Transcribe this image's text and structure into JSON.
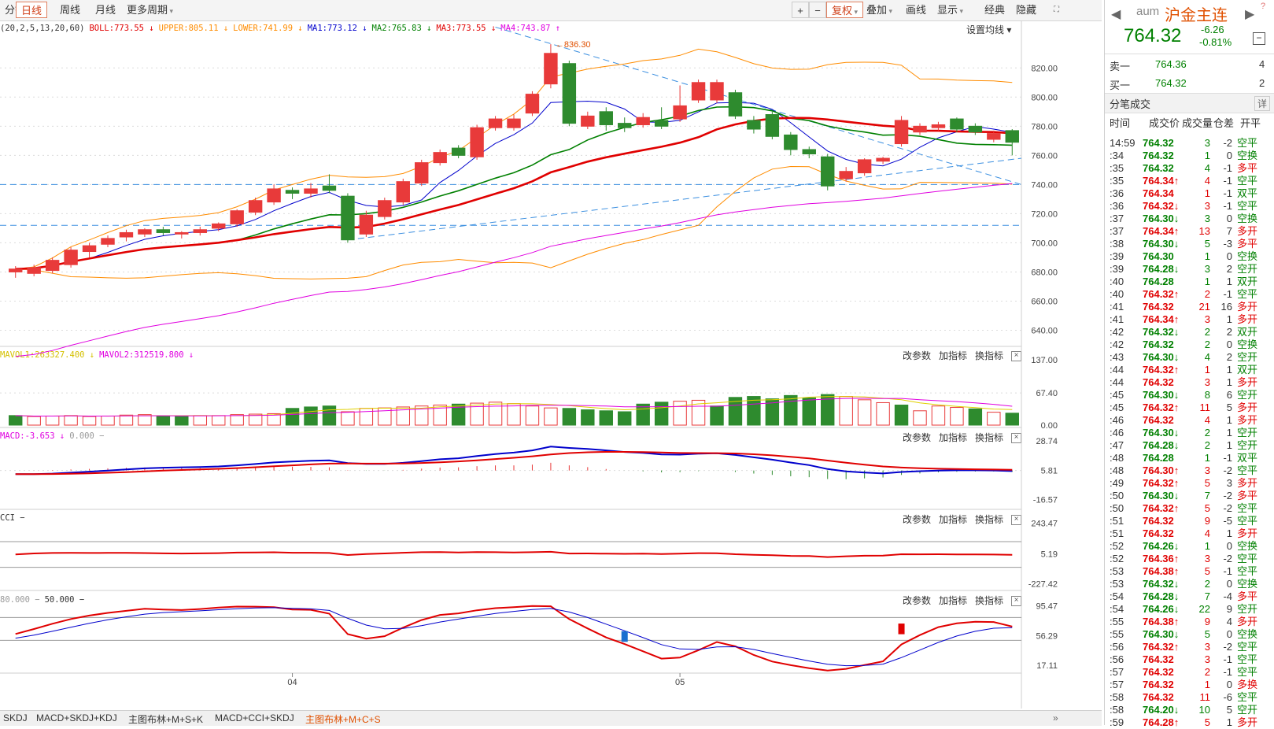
{
  "toolbar": {
    "period_tabs": [
      "分钟",
      "日线",
      "周线",
      "月线",
      "更多周期"
    ],
    "selected_tab": "日线",
    "buttons": [
      "+",
      "−",
      "复权",
      "叠加",
      "画线",
      "显示",
      "经典",
      "隐藏"
    ],
    "selected_button": "复权"
  },
  "main_legend": [
    {
      "text": "(20,2,5,13,20,60)",
      "color": "#333333"
    },
    {
      "text": "BOLL:773.55 ↓",
      "color": "#e00000"
    },
    {
      "text": "UPPER:805.11 ↓",
      "color": "#ff8c00"
    },
    {
      "text": "LOWER:741.99 ↓",
      "color": "#ff8c00"
    },
    {
      "text": "MA1:773.12 ↓",
      "color": "#0000cc"
    },
    {
      "text": "MA2:765.83 ↓",
      "color": "#008000"
    },
    {
      "text": "MA3:773.55 ↓",
      "color": "#e00000"
    },
    {
      "text": "MA4:743.87 ↑",
      "color": "#e000e0"
    }
  ],
  "settings_label": "设置均线",
  "price_axis": [
    "820.00",
    "800.00",
    "780.00",
    "760.00",
    "740.00",
    "720.00",
    "700.00",
    "680.00",
    "660.00",
    "640.00"
  ],
  "peak_label": "836.30",
  "vol_legend": [
    {
      "text": "MAVOL1:263327.400 ↓",
      "color": "#d4c000"
    },
    {
      "text": "MAVOL2:312519.800 ↓",
      "color": "#e000e0"
    }
  ],
  "vol_axis": [
    "137.00",
    "67.40",
    "0.00"
  ],
  "macd_legend": [
    {
      "text": "MACD:-3.653 ↓",
      "color": "#e000e0"
    },
    {
      "text": "0.000 −",
      "color": "#999999"
    }
  ],
  "macd_axis": [
    "28.74",
    "5.81",
    "-16.57"
  ],
  "cci_legend": [
    {
      "text": "CCI −",
      "color": "#333333"
    }
  ],
  "cci_axis": [
    "243.47",
    "5.19",
    "-227.42"
  ],
  "kdj_legend": [
    {
      "text": "80.000 −",
      "color": "#999999"
    },
    {
      "text": "50.000 −",
      "color": "#333333"
    }
  ],
  "kdj_axis": [
    "95.47",
    "56.29",
    "17.11"
  ],
  "pane_tools": [
    "改参数",
    "加指标",
    "换指标"
  ],
  "date_labels": [
    "04",
    "05"
  ],
  "bottom_tabs": [
    "SKDJ",
    "MACD+SKDJ+KDJ",
    "主图布林+M+S+K",
    "MACD+CCI+SKDJ",
    "主图布林+M+C+S"
  ],
  "selected_bottom_tab": "主图布林+M+C+S",
  "quote": {
    "code": "aum",
    "name": "沪金主连",
    "price": "764.32",
    "change": "-6.26",
    "change_pct": "-0.81%",
    "sell_label": "卖一",
    "sell_price": "764.36",
    "sell_vol": "4",
    "buy_label": "买一",
    "buy_price": "764.32",
    "buy_vol": "2",
    "ticks_title": "分笔成交",
    "detail_label": "详",
    "header": [
      "时间",
      "成交价",
      "成交量",
      "仓差",
      "开平"
    ]
  },
  "ticks": [
    {
      "t": "14:59",
      "p": "764.32",
      "a": "",
      "v": "3",
      "d": "-2",
      "k": "空平",
      "c": "dn"
    },
    {
      "t": ":34",
      "p": "764.32",
      "a": "",
      "v": "1",
      "d": "0",
      "k": "空换",
      "c": "dn"
    },
    {
      "t": ":35",
      "p": "764.32",
      "a": "",
      "v": "4",
      "d": "-1",
      "k": "多平",
      "c": "dn"
    },
    {
      "t": ":35",
      "p": "764.34",
      "a": "↑",
      "v": "4",
      "d": "-1",
      "k": "空平",
      "c": "up"
    },
    {
      "t": ":36",
      "p": "764.34",
      "a": "",
      "v": "1",
      "d": "-1",
      "k": "双平",
      "c": "up"
    },
    {
      "t": ":36",
      "p": "764.32",
      "a": "↓",
      "v": "3",
      "d": "-1",
      "k": "空平",
      "c": "up"
    },
    {
      "t": ":37",
      "p": "764.30",
      "a": "↓",
      "v": "3",
      "d": "0",
      "k": "空换",
      "c": "dn"
    },
    {
      "t": ":37",
      "p": "764.34",
      "a": "↑",
      "v": "13",
      "d": "7",
      "k": "多开",
      "c": "up"
    },
    {
      "t": ":38",
      "p": "764.30",
      "a": "↓",
      "v": "5",
      "d": "-3",
      "k": "多平",
      "c": "dn"
    },
    {
      "t": ":39",
      "p": "764.30",
      "a": "",
      "v": "1",
      "d": "0",
      "k": "空换",
      "c": "dn"
    },
    {
      "t": ":39",
      "p": "764.28",
      "a": "↓",
      "v": "3",
      "d": "2",
      "k": "空开",
      "c": "dn"
    },
    {
      "t": ":40",
      "p": "764.28",
      "a": "",
      "v": "1",
      "d": "1",
      "k": "双开",
      "c": "dn"
    },
    {
      "t": ":40",
      "p": "764.32",
      "a": "↑",
      "v": "2",
      "d": "-1",
      "k": "空平",
      "c": "up"
    },
    {
      "t": ":41",
      "p": "764.32",
      "a": "",
      "v": "21",
      "d": "16",
      "k": "多开",
      "c": "up"
    },
    {
      "t": ":41",
      "p": "764.34",
      "a": "↑",
      "v": "3",
      "d": "1",
      "k": "多开",
      "c": "up"
    },
    {
      "t": ":42",
      "p": "764.32",
      "a": "↓",
      "v": "2",
      "d": "2",
      "k": "双开",
      "c": "dn"
    },
    {
      "t": ":42",
      "p": "764.32",
      "a": "",
      "v": "2",
      "d": "0",
      "k": "空换",
      "c": "dn"
    },
    {
      "t": ":43",
      "p": "764.30",
      "a": "↓",
      "v": "4",
      "d": "2",
      "k": "空开",
      "c": "dn"
    },
    {
      "t": ":44",
      "p": "764.32",
      "a": "↑",
      "v": "1",
      "d": "1",
      "k": "双开",
      "c": "up"
    },
    {
      "t": ":44",
      "p": "764.32",
      "a": "",
      "v": "3",
      "d": "1",
      "k": "多开",
      "c": "up"
    },
    {
      "t": ":45",
      "p": "764.30",
      "a": "↓",
      "v": "8",
      "d": "6",
      "k": "空开",
      "c": "dn"
    },
    {
      "t": ":45",
      "p": "764.32",
      "a": "↑",
      "v": "11",
      "d": "5",
      "k": "多开",
      "c": "up"
    },
    {
      "t": ":46",
      "p": "764.32",
      "a": "",
      "v": "4",
      "d": "1",
      "k": "多开",
      "c": "up"
    },
    {
      "t": ":46",
      "p": "764.30",
      "a": "↓",
      "v": "2",
      "d": "1",
      "k": "空开",
      "c": "dn"
    },
    {
      "t": ":47",
      "p": "764.28",
      "a": "↓",
      "v": "2",
      "d": "1",
      "k": "空开",
      "c": "dn"
    },
    {
      "t": ":48",
      "p": "764.28",
      "a": "",
      "v": "1",
      "d": "-1",
      "k": "双平",
      "c": "dn"
    },
    {
      "t": ":48",
      "p": "764.30",
      "a": "↑",
      "v": "3",
      "d": "-2",
      "k": "空平",
      "c": "up"
    },
    {
      "t": ":49",
      "p": "764.32",
      "a": "↑",
      "v": "5",
      "d": "3",
      "k": "多开",
      "c": "up"
    },
    {
      "t": ":50",
      "p": "764.30",
      "a": "↓",
      "v": "7",
      "d": "-2",
      "k": "多平",
      "c": "dn"
    },
    {
      "t": ":50",
      "p": "764.32",
      "a": "↑",
      "v": "5",
      "d": "-2",
      "k": "空平",
      "c": "up"
    },
    {
      "t": ":51",
      "p": "764.32",
      "a": "",
      "v": "9",
      "d": "-5",
      "k": "空平",
      "c": "up"
    },
    {
      "t": ":51",
      "p": "764.32",
      "a": "",
      "v": "4",
      "d": "1",
      "k": "多开",
      "c": "up"
    },
    {
      "t": ":52",
      "p": "764.26",
      "a": "↓",
      "v": "1",
      "d": "0",
      "k": "空换",
      "c": "dn"
    },
    {
      "t": ":52",
      "p": "764.36",
      "a": "↑",
      "v": "3",
      "d": "-2",
      "k": "空平",
      "c": "up"
    },
    {
      "t": ":53",
      "p": "764.38",
      "a": "↑",
      "v": "5",
      "d": "-1",
      "k": "空平",
      "c": "up"
    },
    {
      "t": ":53",
      "p": "764.32",
      "a": "↓",
      "v": "2",
      "d": "0",
      "k": "空换",
      "c": "dn"
    },
    {
      "t": ":54",
      "p": "764.28",
      "a": "↓",
      "v": "7",
      "d": "-4",
      "k": "多平",
      "c": "dn"
    },
    {
      "t": ":54",
      "p": "764.26",
      "a": "↓",
      "v": "22",
      "d": "9",
      "k": "空开",
      "c": "dn"
    },
    {
      "t": ":55",
      "p": "764.38",
      "a": "↑",
      "v": "9",
      "d": "4",
      "k": "多开",
      "c": "up"
    },
    {
      "t": ":55",
      "p": "764.30",
      "a": "↓",
      "v": "5",
      "d": "0",
      "k": "空换",
      "c": "dn"
    },
    {
      "t": ":56",
      "p": "764.32",
      "a": "↑",
      "v": "3",
      "d": "-2",
      "k": "空平",
      "c": "up"
    },
    {
      "t": ":56",
      "p": "764.32",
      "a": "",
      "v": "3",
      "d": "-1",
      "k": "空平",
      "c": "up"
    },
    {
      "t": ":57",
      "p": "764.32",
      "a": "",
      "v": "2",
      "d": "-1",
      "k": "空平",
      "c": "up"
    },
    {
      "t": ":57",
      "p": "764.32",
      "a": "",
      "v": "1",
      "d": "0",
      "k": "多换",
      "c": "up"
    },
    {
      "t": ":58",
      "p": "764.32",
      "a": "",
      "v": "11",
      "d": "-6",
      "k": "空平",
      "c": "up"
    },
    {
      "t": ":58",
      "p": "764.20",
      "a": "↓",
      "v": "10",
      "d": "5",
      "k": "空开",
      "c": "dn"
    },
    {
      "t": ":59",
      "p": "764.28",
      "a": "↑",
      "v": "5",
      "d": "1",
      "k": "多开",
      "c": "up"
    }
  ],
  "chart_data": {
    "type": "candlestick",
    "candles": [
      [
        680,
        682,
        676,
        684
      ],
      [
        679,
        683,
        677,
        685
      ],
      [
        681,
        688,
        679,
        690
      ],
      [
        685,
        695,
        683,
        697
      ],
      [
        694,
        698,
        690,
        700
      ],
      [
        699,
        703,
        697,
        705
      ],
      [
        704,
        707,
        701,
        709
      ],
      [
        706,
        709,
        704,
        710
      ],
      [
        709,
        707,
        705,
        711
      ],
      [
        706,
        707,
        703,
        708
      ],
      [
        707,
        709,
        705,
        711
      ],
      [
        710,
        713,
        708,
        714
      ],
      [
        713,
        722,
        711,
        723
      ],
      [
        721,
        729,
        719,
        731
      ],
      [
        728,
        737,
        726,
        740
      ],
      [
        736,
        734,
        730,
        738
      ],
      [
        734,
        737,
        731,
        741
      ],
      [
        739,
        736,
        734,
        747
      ],
      [
        732,
        702,
        700,
        734
      ],
      [
        706,
        719,
        704,
        722
      ],
      [
        718,
        729,
        716,
        731
      ],
      [
        728,
        742,
        726,
        744
      ],
      [
        741,
        755,
        739,
        757
      ],
      [
        755,
        762,
        753,
        764
      ],
      [
        765,
        760,
        758,
        767
      ],
      [
        759,
        779,
        757,
        781
      ],
      [
        779,
        785,
        777,
        787
      ],
      [
        779,
        785,
        777,
        788
      ],
      [
        789,
        802,
        787,
        804
      ],
      [
        809,
        830,
        806,
        836.3
      ],
      [
        823,
        782,
        780,
        825
      ],
      [
        780,
        787,
        778,
        790
      ],
      [
        790,
        781,
        777,
        793
      ],
      [
        782,
        779,
        776,
        786
      ],
      [
        781,
        786,
        779,
        789
      ],
      [
        784,
        780,
        778,
        793
      ],
      [
        785,
        794,
        783,
        808
      ],
      [
        798,
        810,
        796,
        812
      ],
      [
        798,
        810,
        796,
        812
      ],
      [
        803,
        787,
        785,
        805
      ],
      [
        784,
        778,
        775,
        787
      ],
      [
        788,
        773,
        771,
        790
      ],
      [
        774,
        764,
        760,
        776
      ],
      [
        764,
        761,
        758,
        766
      ],
      [
        759,
        739,
        736,
        761
      ],
      [
        744,
        749,
        742,
        752
      ],
      [
        748,
        757,
        746,
        758
      ],
      [
        756,
        758,
        754,
        759
      ],
      [
        768,
        784,
        766,
        787
      ],
      [
        776,
        780,
        774,
        782
      ],
      [
        779,
        781,
        777,
        783
      ],
      [
        785,
        778,
        776,
        786
      ],
      [
        780,
        776,
        774,
        782
      ],
      [
        771,
        775,
        769,
        777
      ],
      [
        777,
        769,
        760,
        778
      ]
    ],
    "price_axis_range": [
      630,
      845
    ],
    "volumes": [
      20,
      18,
      19,
      20,
      18,
      19,
      21,
      22,
      19,
      18,
      20,
      20,
      22,
      23,
      24,
      35,
      38,
      40,
      28,
      35,
      36,
      38,
      40,
      42,
      44,
      46,
      48,
      45,
      40,
      36,
      35,
      32,
      30,
      28,
      44,
      48,
      50,
      52,
      40,
      58,
      60,
      55,
      62,
      57,
      64,
      60,
      53,
      47,
      42,
      30,
      40,
      37,
      34,
      27,
      25
    ],
    "volume_down_flags": [
      1,
      0,
      0,
      0,
      0,
      0,
      0,
      0,
      1,
      1,
      0,
      0,
      0,
      0,
      0,
      1,
      1,
      1,
      0,
      0,
      0,
      0,
      0,
      0,
      1,
      0,
      0,
      0,
      0,
      0,
      1,
      1,
      1,
      1,
      1,
      1,
      0,
      0,
      1,
      1,
      1,
      1,
      1,
      1,
      1,
      0,
      0,
      0,
      1,
      0,
      0,
      0,
      1,
      0,
      1
    ],
    "volume_axis_range": [
      0,
      140
    ],
    "macd_axis_range": [
      -20,
      30
    ],
    "cci_axis_range": [
      -250,
      260
    ],
    "kdj_axis_range": [
      10,
      100
    ]
  }
}
